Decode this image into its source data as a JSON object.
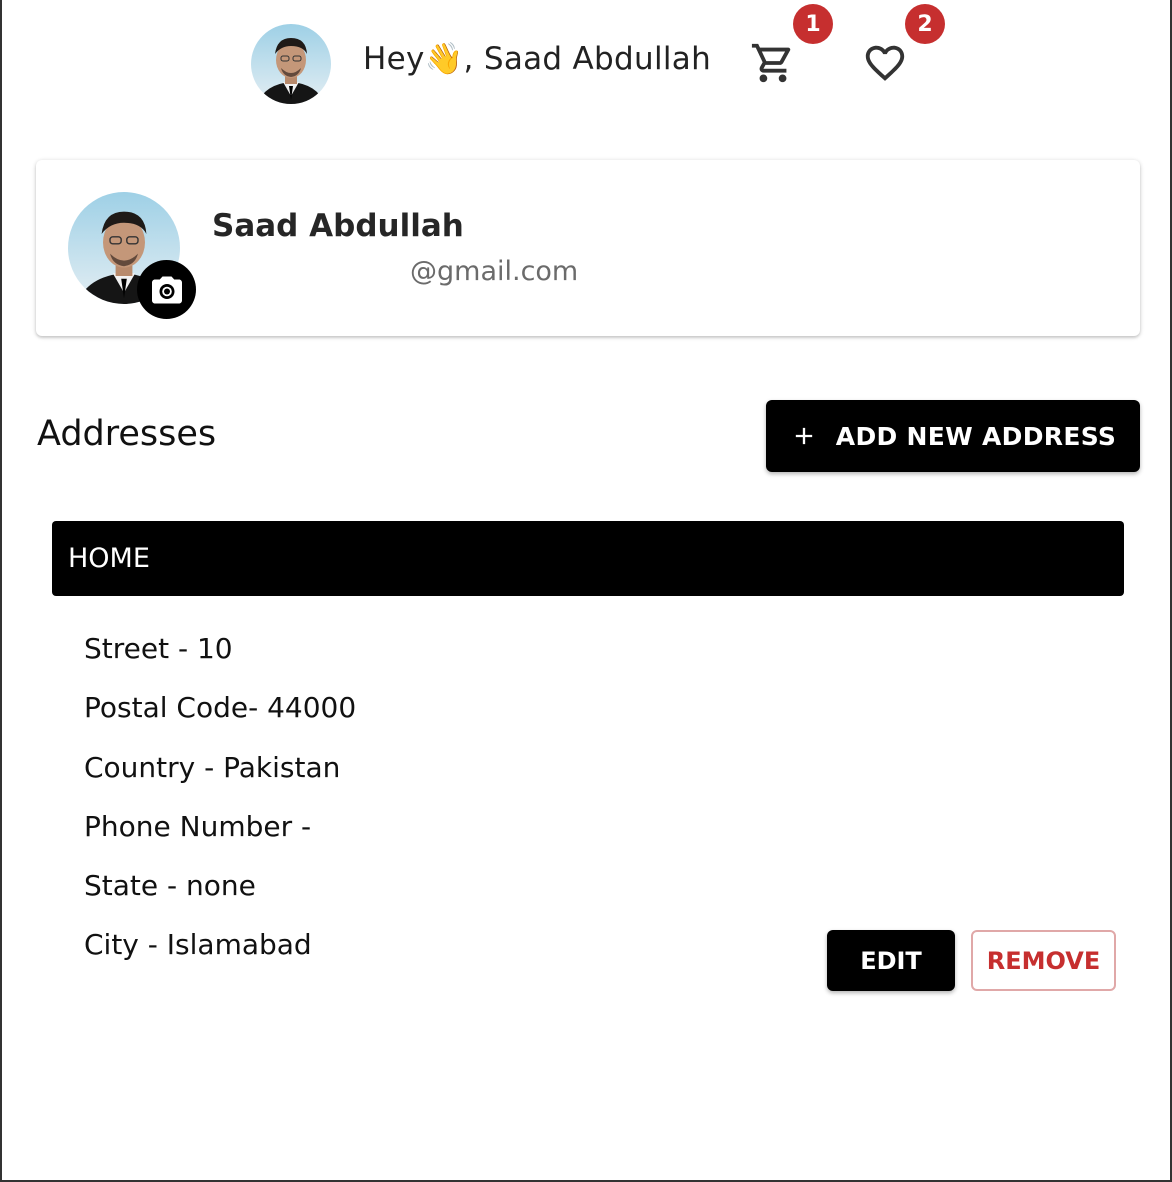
{
  "header": {
    "greeting": "Hey👋, Saad Abdullah",
    "cart_count": "1",
    "wishlist_count": "2"
  },
  "profile": {
    "name": "Saad Abdullah",
    "email": "@gmail.com"
  },
  "addresses": {
    "title": "Addresses",
    "add_button_label": "ADD NEW ADDRESS",
    "items": [
      {
        "label": "HOME",
        "lines": [
          "Street - 10",
          "Postal Code- 44000",
          "Country - Pakistan",
          "Phone Number -",
          "State - none",
          "City - Islamabad"
        ],
        "edit_label": "EDIT",
        "remove_label": "REMOVE"
      }
    ]
  },
  "colors": {
    "badge": "#c62f2f",
    "primary": "#000000",
    "danger_text": "#c62f2f"
  },
  "icons": [
    "avatar",
    "cart-icon",
    "heart-icon",
    "camera-icon",
    "plus-icon"
  ]
}
